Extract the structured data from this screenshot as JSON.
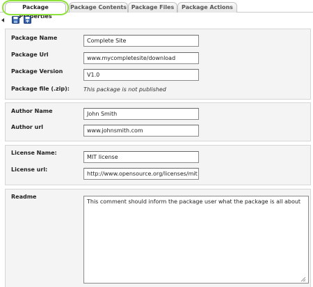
{
  "tabs": [
    {
      "label": "Package Properties",
      "active": true
    },
    {
      "label": "Package Contents",
      "active": false
    },
    {
      "label": "Package Files",
      "active": false
    },
    {
      "label": "Package Actions",
      "active": false
    }
  ],
  "toolbar": {
    "icons": [
      "back-arrow-icon",
      "save-icon",
      "save-and-close-icon"
    ]
  },
  "package": {
    "name_label": "Package Name",
    "name_value": "Complete Site",
    "url_label": "Package Url",
    "url_value": "www.mycompletesite/download",
    "version_label": "Package Version",
    "version_value": "V1.0",
    "file_label": "Package file (.zip):",
    "file_value": "This package is not published"
  },
  "author": {
    "name_label": "Author Name",
    "name_value": "John Smith",
    "url_label": "Author url",
    "url_value": "www.johnsmith.com"
  },
  "license": {
    "name_label": "License Name:",
    "name_value": "MIT license",
    "url_label": "License url:",
    "url_value": "http://www.opensource.org/licenses/mit"
  },
  "readme": {
    "label": "Readme",
    "value": "This comment should inform the package user what the package is all about"
  },
  "colors": {
    "highlight": "#8ee23b",
    "panel_bg": "#f4f4f4",
    "icon_blue": "#2f5fa8"
  }
}
